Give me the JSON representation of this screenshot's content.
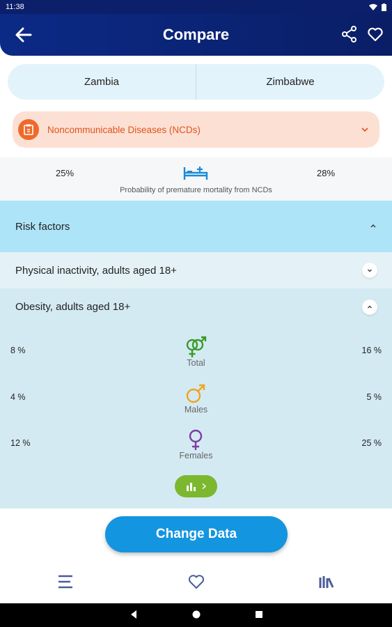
{
  "status_bar": {
    "time": "11:38"
  },
  "app_bar": {
    "title": "Compare"
  },
  "countries": {
    "left": "Zambia",
    "right": "Zimbabwe"
  },
  "topic": {
    "label": "Noncommunicable Diseases (NCDs)",
    "accent": "#ee6a2c"
  },
  "mortality": {
    "left_value": "25%",
    "right_value": "28%",
    "caption": "Probability of premature mortality from NCDs"
  },
  "risk_factors": {
    "header": "Risk factors",
    "items": [
      {
        "label": "Physical inactivity, adults aged 18+"
      },
      {
        "label": "Obesity, adults aged 18+"
      }
    ]
  },
  "obesity": {
    "rows": [
      {
        "left": "8 %",
        "right": "16 %",
        "label": "Total",
        "icon": "gender-total-icon"
      },
      {
        "left": "4 %",
        "right": "5 %",
        "label": "Males",
        "icon": "male-icon"
      },
      {
        "left": "12 %",
        "right": "25 %",
        "label": "Females",
        "icon": "female-icon"
      }
    ]
  },
  "actions": {
    "change_data": "Change Data"
  },
  "colors": {
    "brand": "#0b2a86",
    "risk_header": "#aee4f8",
    "button": "#1495df",
    "chart_button": "#7cb82f"
  }
}
